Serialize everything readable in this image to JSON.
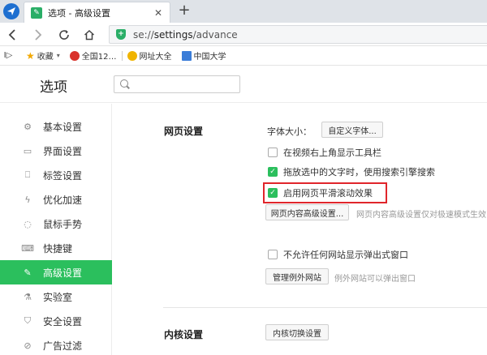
{
  "tab": {
    "title": "选项 - 高级设置",
    "close": "✕",
    "new_tab": "+"
  },
  "address": {
    "scheme": "se://",
    "path": "settings",
    "rest": "/advance"
  },
  "bookmarks": {
    "toggle": "I▷",
    "items": [
      {
        "label": "收藏",
        "caret": "▾"
      },
      {
        "label": "全国12…"
      },
      {
        "label": "网址大全"
      },
      {
        "label": "中国大学"
      }
    ]
  },
  "settings": {
    "title": "选项",
    "search_placeholder": "",
    "sidebar": [
      {
        "label": "基本设置",
        "icon": "gear-icon"
      },
      {
        "label": "界面设置",
        "icon": "window-icon"
      },
      {
        "label": "标签设置",
        "icon": "tab-icon"
      },
      {
        "label": "优化加速",
        "icon": "lightning-icon"
      },
      {
        "label": "鼠标手势",
        "icon": "mouse-icon"
      },
      {
        "label": "快捷键",
        "icon": "keyboard-icon"
      },
      {
        "label": "高级设置",
        "icon": "wrench-icon"
      },
      {
        "label": "实验室",
        "icon": "flask-icon"
      },
      {
        "label": "安全设置",
        "icon": "shield-icon"
      },
      {
        "label": "广告过滤",
        "icon": "block-icon"
      }
    ],
    "web_section": {
      "title": "网页设置",
      "font_size_label": "字体大小：",
      "custom_font_button": "自定义字体...",
      "checkboxes": [
        {
          "label": "在视频右上角显示工具栏",
          "checked": false
        },
        {
          "label": "拖放选中的文字时，使用搜索引擎搜索",
          "checked": true
        },
        {
          "label": "启用网页平滑滚动效果",
          "checked": true
        }
      ],
      "advanced_button": "网页内容高级设置...",
      "advanced_hint": "网页内容高级设置仅对极速模式生效",
      "popup_checkbox": {
        "label": "不允许任何网站显示弹出式窗口",
        "checked": false
      },
      "manage_exceptions_button": "管理例外网站",
      "exceptions_hint": "例外网站可以弹出窗口"
    },
    "kernel_section": {
      "title": "内核设置",
      "switch_button": "内核切换设置"
    }
  },
  "colors": {
    "accent": "#2bbf5d",
    "highlight": "#e0252b"
  }
}
